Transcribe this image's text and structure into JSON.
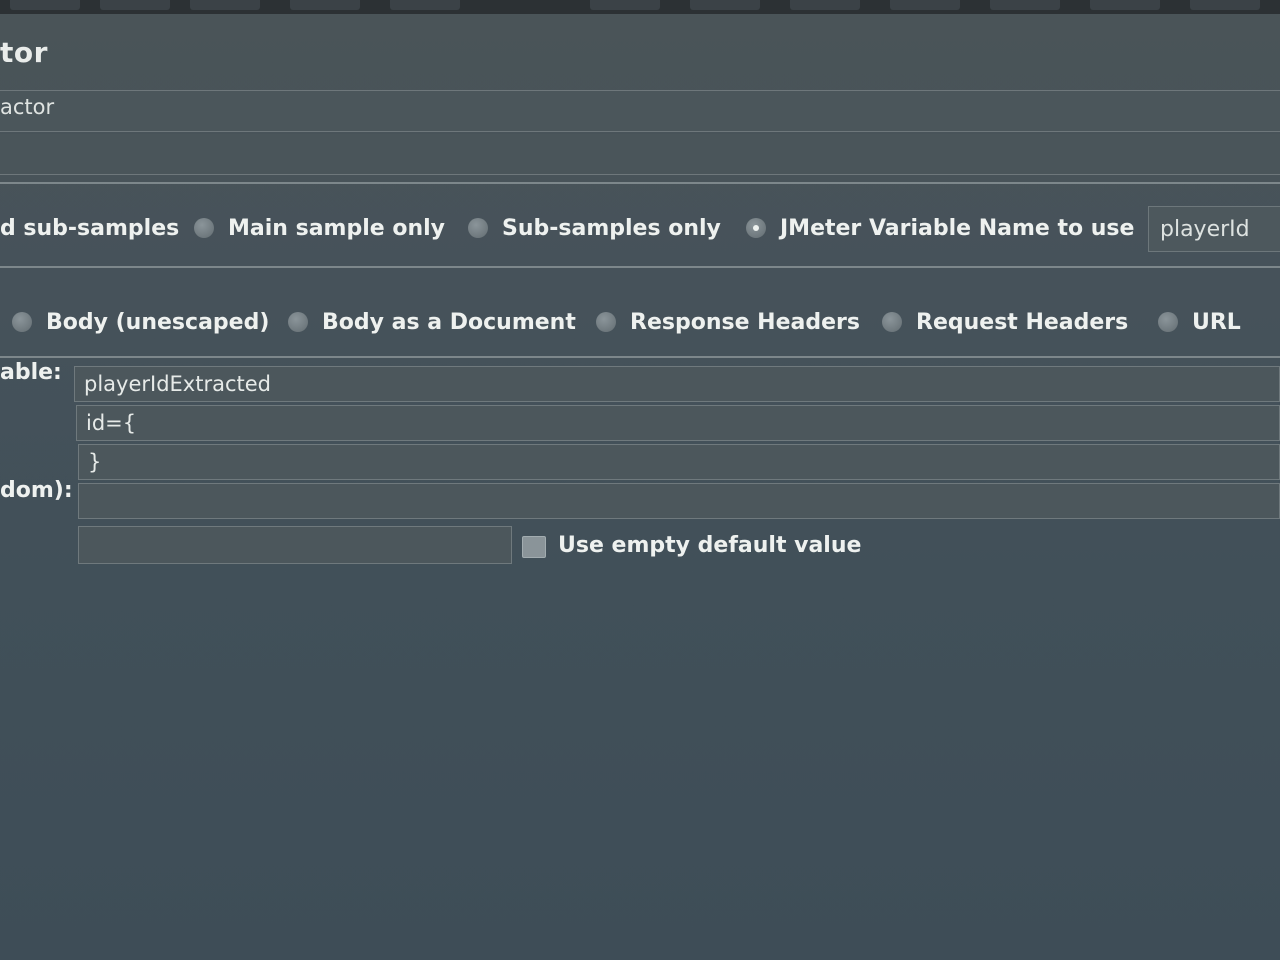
{
  "panel": {
    "title": "tor",
    "name_value": "actor"
  },
  "apply_to": {
    "options": [
      {
        "label": "d sub-samples",
        "checked": false
      },
      {
        "label": "Main sample only",
        "checked": false
      },
      {
        "label": "Sub-samples only",
        "checked": false
      },
      {
        "label": "JMeter Variable Name to use",
        "checked": true
      }
    ],
    "variable_value": "playerId"
  },
  "field_to_check": {
    "options": [
      {
        "label": "Body (unescaped)",
        "checked": false
      },
      {
        "label": "Body as a Document",
        "checked": false
      },
      {
        "label": "Response Headers",
        "checked": false
      },
      {
        "label": "Request Headers",
        "checked": false
      },
      {
        "label": "URL",
        "checked": false
      }
    ]
  },
  "form": {
    "reference_label": "able:",
    "reference_value": "playerIdExtracted",
    "left_boundary_value": "id={",
    "right_boundary_value": "}",
    "match_label": "dom):",
    "match_value": "",
    "default_value": "",
    "use_empty_default_label": "Use empty default value",
    "use_empty_default_checked": false
  }
}
